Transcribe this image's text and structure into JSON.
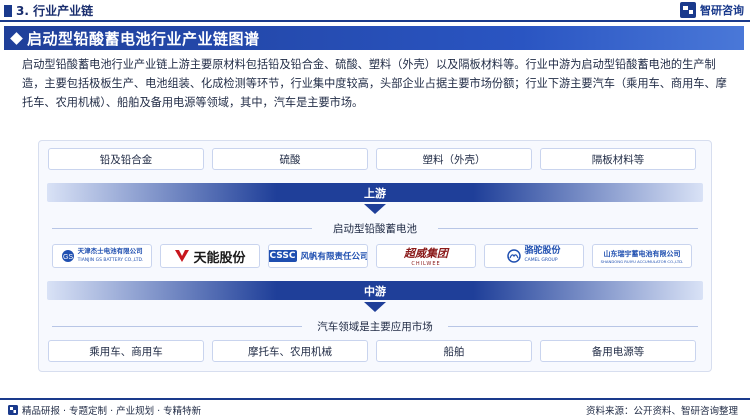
{
  "header": {
    "section_title": "3. 行业产业链",
    "brand_name": "智研咨询"
  },
  "banner": {
    "title": "启动型铅酸蓄电池行业产业链图谱"
  },
  "intro": {
    "text": "启动型铅酸蓄电池行业产业链上游主要原材料包括铅及铅合金、硫酸、塑料（外壳）以及隔板材料等。行业中游为启动型铅酸蓄电池的生产制造，主要包括极板生产、电池组装、化成检测等环节，行业集中度较高，头部企业占据主要市场份额；行业下游主要汽车（乘用车、商用车、摩托车、农用机械）、船舶及备用电源等领域，其中，汽车是主要市场。"
  },
  "upstream": {
    "materials": [
      "铅及铅合金",
      "硫酸",
      "塑料（外壳）",
      "隔板材料等"
    ],
    "stage_label": "上游"
  },
  "midstream": {
    "group_label": "启动型铅酸蓄电池",
    "companies": [
      {
        "name": "天津杰士电池有限公司",
        "sub": "TIANJIN GS BATTERY CO.,LTD.",
        "icon": "gs-logo-icon",
        "color": "#1f4fb0"
      },
      {
        "name": "天能股份",
        "sub": "",
        "icon": "tianneng-logo-icon",
        "color": "#1a1a1a"
      },
      {
        "name": "风帆有限责任公司",
        "sub": "CSSC",
        "icon": "cssc-logo-icon",
        "color": "#1f4fb0"
      },
      {
        "name": "超威集团",
        "sub": "CHILWEE",
        "icon": "chilwee-logo-icon",
        "color": "#8a1a1a"
      },
      {
        "name": "骆驼股份",
        "sub": "CAMEL GROUP",
        "icon": "camel-logo-icon",
        "color": "#1f4fb0"
      },
      {
        "name": "山东瑞宇蓄电池有限公司",
        "sub": "SHANDONG RUIYU ACCUMULATOR CO.,LTD.",
        "icon": "ruiyu-logo-icon",
        "color": "#1f4fb0"
      }
    ],
    "stage_label": "中游"
  },
  "downstream": {
    "group_label": "汽车领域是主要应用市场",
    "applications": [
      "乘用车、商用车",
      "摩托车、农用机械",
      "船舶",
      "备用电源等"
    ]
  },
  "footer": {
    "left_text": "精品研报 · 专题定制 · 产业规划 · 专精特新",
    "source_text": "资料来源：公开资料、智研咨询整理"
  },
  "colors": {
    "primary": "#1f3f99",
    "accent": "#2a55c2",
    "border": "#c9d4ee"
  }
}
